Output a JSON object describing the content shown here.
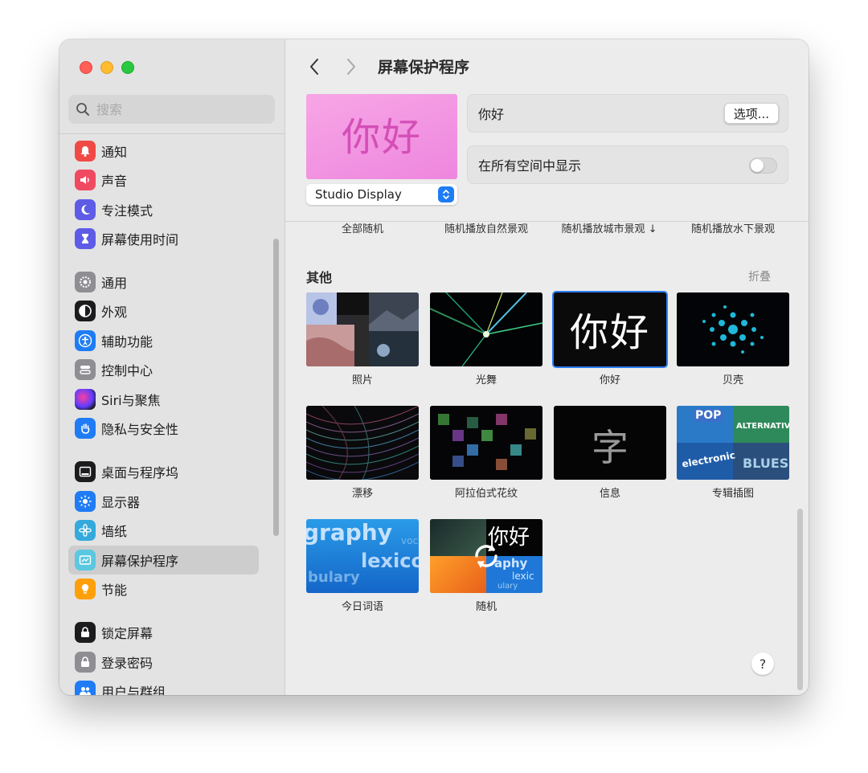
{
  "sidebar": {
    "search_placeholder": "搜索",
    "items": [
      {
        "label": "通知",
        "icon": "bell-icon",
        "color": "#f04a47"
      },
      {
        "label": "声音",
        "icon": "speaker-icon",
        "color": "#f04a63"
      },
      {
        "label": "专注模式",
        "icon": "moon-icon",
        "color": "#5e5ce6"
      },
      {
        "label": "屏幕使用时间",
        "icon": "hourglass-icon",
        "color": "#5e5ce6"
      },
      {
        "label": "通用",
        "icon": "gear-icon",
        "color": "#8e8e93"
      },
      {
        "label": "外观",
        "icon": "appearance-icon",
        "color": "#1c1c1e"
      },
      {
        "label": "辅助功能",
        "icon": "accessibility-icon",
        "color": "#1f7cf5"
      },
      {
        "label": "控制中心",
        "icon": "control-center-icon",
        "color": "#8e8e93"
      },
      {
        "label": "Siri与聚焦",
        "icon": "siri-icon",
        "color": "#3a3a3c"
      },
      {
        "label": "隐私与安全性",
        "icon": "hand-icon",
        "color": "#1f7cf5"
      },
      {
        "label": "桌面与程序坞",
        "icon": "dock-icon",
        "color": "#1c1c1e"
      },
      {
        "label": "显示器",
        "icon": "brightness-icon",
        "color": "#1f7cf5"
      },
      {
        "label": "墙纸",
        "icon": "flower-icon",
        "color": "#34aadc"
      },
      {
        "label": "屏幕保护程序",
        "icon": "screensaver-icon",
        "color": "#5ac8e0"
      },
      {
        "label": "节能",
        "icon": "bulb-icon",
        "color": "#ff9f0a"
      },
      {
        "label": "锁定屏幕",
        "icon": "lock-screen-icon",
        "color": "#1c1c1e"
      },
      {
        "label": "登录密码",
        "icon": "lock-icon",
        "color": "#8e8e93"
      },
      {
        "label": "用户与群组",
        "icon": "users-icon",
        "color": "#1f7cf5"
      }
    ]
  },
  "header": {
    "title": "屏幕保护程序",
    "preview_text": "你好",
    "display_select": "Studio Display",
    "current_saver": "你好",
    "options_button": "选项...",
    "show_all_spaces_label": "在所有空间中显示",
    "show_all_spaces_on": false
  },
  "shuffle_labels": [
    "全部随机",
    "随机播放自然景观",
    "随机播放城市景观 ↓",
    "随机播放水下景观"
  ],
  "section": {
    "title": "其他",
    "collapse": "折叠",
    "savers": [
      {
        "label": "照片",
        "selected": false
      },
      {
        "label": "光舞",
        "selected": false
      },
      {
        "label": "你好",
        "selected": true,
        "tile_text": "你好"
      },
      {
        "label": "贝壳",
        "selected": false
      },
      {
        "label": "漂移",
        "selected": false
      },
      {
        "label": "阿拉伯式花纹",
        "selected": false
      },
      {
        "label": "信息",
        "selected": false,
        "tile_text": "字"
      },
      {
        "label": "专辑插图",
        "selected": false,
        "tile_words": [
          "POP",
          "ALTERNATIVE",
          "electronic",
          "BLUES"
        ]
      },
      {
        "label": "今日词语",
        "selected": false,
        "tile_words": [
          "graphy",
          "lexico",
          "bulary",
          "voc"
        ]
      },
      {
        "label": "随机",
        "selected": false,
        "tile_text": "你好",
        "tile_words": [
          "aphy",
          "lexic",
          "ulary"
        ]
      }
    ]
  },
  "help_label": "?",
  "colors": {
    "accent": "#2b7cf4",
    "selected_bg": "#cdcdcd"
  }
}
